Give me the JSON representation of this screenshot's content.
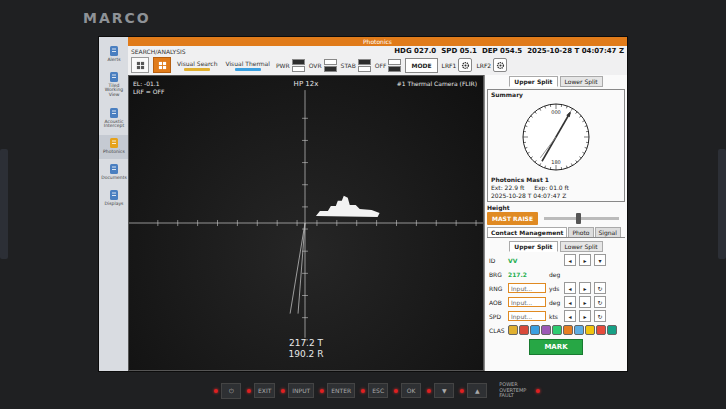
{
  "brand": "MARCO",
  "window": {
    "title": "Photonics"
  },
  "sidebar": {
    "items": [
      {
        "label": "Alerts",
        "selected": false
      },
      {
        "label": "Tiled Working View",
        "selected": false
      },
      {
        "label": "Acoustic Intercept",
        "selected": false
      },
      {
        "label": "Photonics",
        "selected": true
      },
      {
        "label": "Documents",
        "selected": false
      },
      {
        "label": "Displays",
        "selected": false
      }
    ]
  },
  "toolbar": {
    "section": "SEARCH/ANALYSIS",
    "view_buttons": [
      {
        "selected": false
      },
      {
        "selected": true
      }
    ],
    "mode_buttons": [
      {
        "label": "Visual Search",
        "color": "#e0b030"
      },
      {
        "label": "Visual Thermal",
        "color": "#3aa0e0"
      }
    ],
    "switches": [
      {
        "label": "PWR",
        "on": true
      },
      {
        "label": "OVR",
        "on": false
      },
      {
        "label": "STAB",
        "on": true
      },
      {
        "label": "OFF",
        "on": false
      }
    ],
    "mode": "MODE",
    "lrf": [
      {
        "label": "LRF1"
      },
      {
        "label": "LRF2"
      }
    ]
  },
  "status": {
    "hdg": "HDG 027.0",
    "spd": "SPD 05.1",
    "dep": "DEP 054.5",
    "time": "2025-10-28 T 04:07:47 Z"
  },
  "video": {
    "elevation": "EL: -01.1",
    "lrf": "LRF = OFF",
    "zoom": "HP 12x",
    "camera": "#1 Thermal Camera (FLIR)",
    "bearing_true": "217.2 T",
    "bearing_relative": "190.2 R"
  },
  "panel_tabs": [
    {
      "label": "Upper Split",
      "selected": true
    },
    {
      "label": "Lower Split",
      "selected": false
    }
  ],
  "summary": {
    "title": "Summary",
    "compass": {
      "top": "000",
      "bottom": "180",
      "needle_deg": 30,
      "bearing_deg": 217
    },
    "mast": "Photonics Mast 1",
    "ext": "Ext: 22.9 ft",
    "exp": "Exp: 01.0 ft",
    "time": "2025-10-28 T 04:07:47 Z"
  },
  "height": {
    "label": "Height",
    "button": "MAST RAISE",
    "level": 0.45
  },
  "contact_tabs": [
    {
      "label": "Contact Management",
      "selected": true
    },
    {
      "label": "Photo",
      "selected": false
    },
    {
      "label": "Signal",
      "selected": false
    }
  ],
  "split_tabs": [
    {
      "label": "Upper Split",
      "selected": true
    },
    {
      "label": "Lower Split",
      "selected": false
    }
  ],
  "fields": [
    {
      "label": "ID",
      "kind": "text",
      "value": "VV",
      "unit": "",
      "buttons": [
        "◂",
        "▸",
        "▾"
      ]
    },
    {
      "label": "BRG",
      "kind": "text",
      "value": "217.2",
      "unit": "deg",
      "buttons": []
    },
    {
      "label": "RNG",
      "kind": "input",
      "value": "Input...",
      "unit": "yds",
      "buttons": [
        "◂",
        "▸",
        "↻"
      ]
    },
    {
      "label": "AOB",
      "kind": "input",
      "value": "Input...",
      "unit": "deg",
      "buttons": [
        "◂",
        "▸",
        "↻"
      ]
    },
    {
      "label": "SPD",
      "kind": "input",
      "value": "Input...",
      "unit": "kts",
      "buttons": [
        "◂",
        "▸",
        "↻"
      ]
    }
  ],
  "clas": {
    "label": "CLAS",
    "colors": [
      "#e0b030",
      "#d94a3a",
      "#3aa0e0",
      "#9b59b6",
      "#2ecc71",
      "#e67e22",
      "#5dade2",
      "#f1c40f",
      "#e74c3c",
      "#16a085"
    ]
  },
  "mark": "MARK",
  "bezel_buttons": [
    {
      "label": "⏻"
    },
    {
      "label": "EXIT"
    },
    {
      "label": "INPUT"
    },
    {
      "label": "ENTER"
    },
    {
      "label": "ESC"
    },
    {
      "label": "OK"
    },
    {
      "label": "▼"
    },
    {
      "label": "▲"
    }
  ],
  "fault_label": "POWER OVERTEMP FAULT"
}
